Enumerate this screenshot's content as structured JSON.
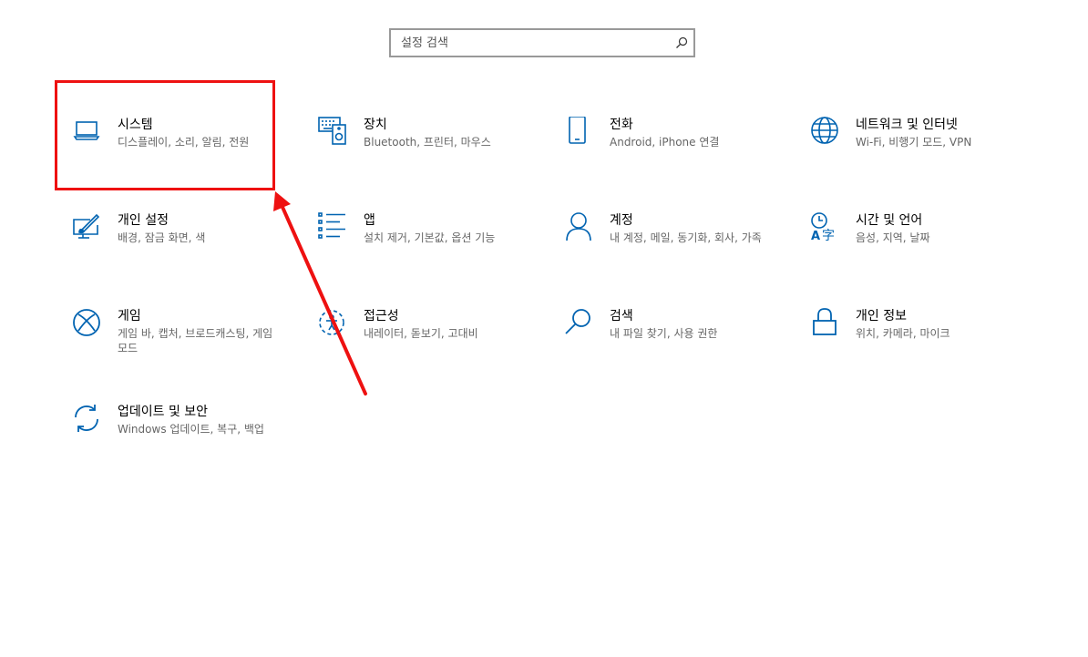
{
  "search": {
    "placeholder": "설정 검색",
    "icon": "search-icon"
  },
  "colors": {
    "accent": "#0063b1",
    "annotation": "#ee1111",
    "description_text": "#666666"
  },
  "tiles": [
    {
      "title": "시스템",
      "desc": "디스플레이, 소리, 알림, 전원",
      "icon": "laptop-icon"
    },
    {
      "title": "장치",
      "desc": "Bluetooth, 프린터, 마우스",
      "icon": "devices-icon"
    },
    {
      "title": "전화",
      "desc": "Android, iPhone 연결",
      "icon": "phone-icon"
    },
    {
      "title": "네트워크 및 인터넷",
      "desc": "Wi-Fi, 비행기 모드, VPN",
      "icon": "globe-icon"
    },
    {
      "title": "개인 설정",
      "desc": "배경, 잠금 화면, 색",
      "icon": "personalization-icon"
    },
    {
      "title": "앱",
      "desc": "설치 제거, 기본값, 옵션 기능",
      "icon": "apps-list-icon"
    },
    {
      "title": "계정",
      "desc": "내 계정, 메일, 동기화, 회사, 가족",
      "icon": "person-icon"
    },
    {
      "title": "시간 및 언어",
      "desc": "음성, 지역, 날짜",
      "icon": "time-language-icon"
    },
    {
      "title": "게임",
      "desc": "게임 바, 캡처, 브로드캐스팅, 게임 모드",
      "icon": "xbox-icon"
    },
    {
      "title": "접근성",
      "desc": "내레이터, 돋보기, 고대비",
      "icon": "ease-of-access-icon"
    },
    {
      "title": "검색",
      "desc": "내 파일 찾기, 사용 권한",
      "icon": "magnifier-icon"
    },
    {
      "title": "개인 정보",
      "desc": "위치, 카메라, 마이크",
      "icon": "lock-icon"
    },
    {
      "title": "업데이트 및 보안",
      "desc": "Windows 업데이트, 복구, 백업",
      "icon": "sync-icon"
    }
  ],
  "annotation": {
    "highlighted_tile": "시스템",
    "arrow_color": "#ee1111"
  }
}
